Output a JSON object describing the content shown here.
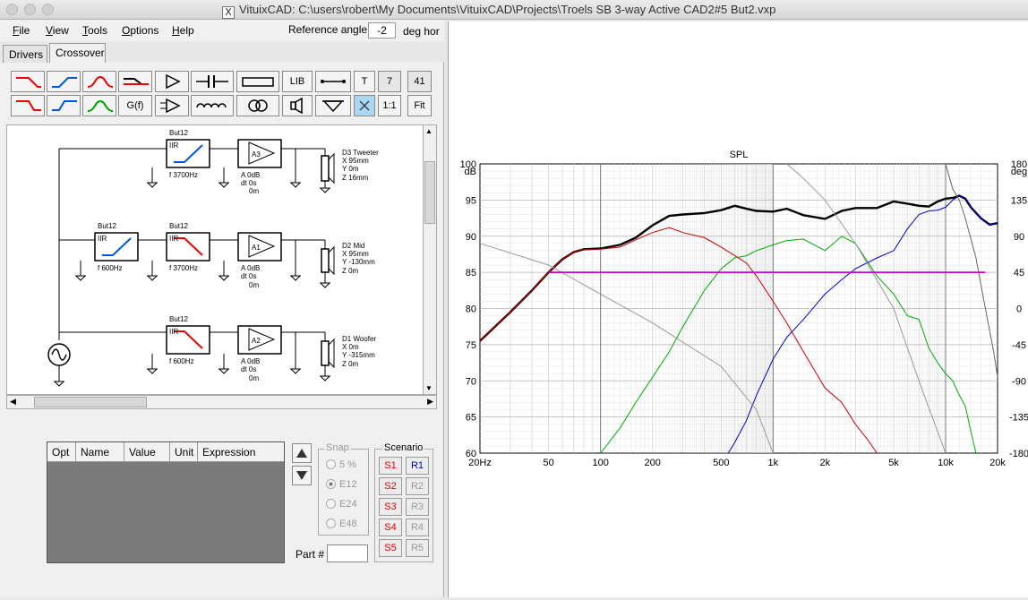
{
  "window": {
    "title": "VituixCAD: C:\\users\\robert\\My Documents\\VituixCAD\\Projects\\Troels SB 3-way Active CAD2#5 But2.vxp"
  },
  "menu": [
    "File",
    "View",
    "Tools",
    "Options",
    "Help"
  ],
  "menu_accel": [
    "F",
    "V",
    "T",
    "O",
    "H"
  ],
  "reference": {
    "label": "Reference angle",
    "value": "-2",
    "unit": "deg hor"
  },
  "tabs": [
    "Drivers",
    "Crossover"
  ],
  "toolbar": {
    "g_label": "G(f)",
    "lib_label": "LIB",
    "t_label": "T",
    "count1": "7",
    "count2": "41",
    "one_to_one": "1:1",
    "fit": "Fit"
  },
  "schematic": {
    "blocks": [
      {
        "title": "But12",
        "type": "IIR",
        "freq": "f  3700Hz"
      },
      {
        "title": "But12",
        "type": "IIR",
        "freq": "f  600Hz"
      },
      {
        "title": "But12",
        "type": "IIR",
        "freq": "f  3700Hz"
      },
      {
        "title": "But12",
        "type": "IIR",
        "freq": "f  600Hz"
      }
    ],
    "amps": [
      {
        "label": "A3",
        "gain": "A 0dB",
        "delay": "dt 0s",
        "dist": "0m"
      },
      {
        "label": "A1",
        "gain": "A 0dB",
        "delay": "dt 0s",
        "dist": "0m"
      },
      {
        "label": "A2",
        "gain": "A 0dB",
        "delay": "dt 0s",
        "dist": "0m"
      }
    ],
    "drivers": [
      {
        "name": "D3 Tweeter",
        "x": "X 95mm",
        "y": "Y 0m",
        "z": "Z 16mm"
      },
      {
        "name": "D2 Mid",
        "x": "X 95mm",
        "y": "Y -130mm",
        "z": "Z 0m"
      },
      {
        "name": "D1 Woofer",
        "x": "X 0m",
        "y": "Y -315mm",
        "z": "Z 0m"
      }
    ]
  },
  "params": {
    "headers": [
      "Opt",
      "Name",
      "Value",
      "Unit",
      "Expression"
    ]
  },
  "snap": {
    "label": "Snap",
    "options": [
      "5 %",
      "E12",
      "E24",
      "E48"
    ],
    "selected": "E12"
  },
  "scenario": {
    "label": "Scenario",
    "s": [
      "S1",
      "S2",
      "S3",
      "S4",
      "S5"
    ],
    "r": [
      "R1",
      "R2",
      "R3",
      "R4",
      "R5"
    ]
  },
  "part": {
    "label": "Part #"
  },
  "chart_data": {
    "type": "line",
    "title": "SPL",
    "xlabel": "",
    "ylabel": "dB",
    "y2label": "deg",
    "xscale": "log",
    "xlim": [
      20,
      20000
    ],
    "ylim": [
      60,
      100
    ],
    "y2lim": [
      -180,
      180
    ],
    "xticks": [
      "20Hz",
      "50",
      "100",
      "200",
      "500",
      "1k",
      "2k",
      "5k",
      "10k",
      "20k"
    ],
    "xtick_values": [
      20,
      50,
      100,
      200,
      500,
      1000,
      2000,
      5000,
      10000,
      20000
    ],
    "yticks": [
      60,
      65,
      70,
      75,
      80,
      85,
      90,
      95,
      100
    ],
    "y2ticks": [
      -180,
      -135,
      -90,
      -45,
      0,
      45,
      90,
      135,
      180
    ],
    "grid": true,
    "series": [
      {
        "color": "#000000",
        "x": [
          20,
          30,
          40,
          50,
          60,
          70,
          80,
          100,
          130,
          160,
          200,
          250,
          300,
          400,
          500,
          600,
          700,
          800,
          1000,
          1200,
          1500,
          2000,
          2500,
          3000,
          4000,
          5000,
          6000,
          7000,
          8000,
          9000,
          10000,
          11000,
          12000,
          13000,
          14000,
          16000,
          18000,
          20000
        ],
        "y": [
          75.5,
          79.5,
          82.5,
          85.0,
          86.8,
          87.8,
          88.2,
          88.3,
          88.8,
          89.8,
          91.5,
          92.8,
          93.0,
          93.2,
          93.6,
          94.2,
          93.8,
          93.5,
          93.4,
          93.8,
          92.9,
          92.4,
          93.5,
          93.9,
          93.9,
          94.8,
          94.5,
          94.2,
          94.1,
          94.8,
          95.2,
          95.3,
          95.6,
          95.2,
          94.0,
          92.5,
          91.6,
          91.8
        ]
      },
      {
        "color": "#cc0000",
        "x": [
          20,
          30,
          40,
          50,
          60,
          70,
          80,
          100,
          130,
          160,
          200,
          250,
          300,
          400,
          500,
          600,
          700,
          800,
          1000,
          1200,
          1500,
          2000,
          2500,
          3000,
          3500,
          4000
        ],
        "y": [
          75.5,
          79.5,
          82.5,
          85.0,
          86.8,
          87.8,
          88.2,
          88.2,
          88.5,
          89.5,
          90.5,
          91.2,
          90.5,
          89.8,
          88.5,
          87.3,
          86.3,
          84.5,
          81.0,
          78.0,
          74.0,
          69.0,
          67.0,
          64.0,
          62.0,
          60.0
        ]
      },
      {
        "color": "#00aa00",
        "x": [
          100,
          130,
          160,
          200,
          250,
          300,
          400,
          500,
          600,
          700,
          800,
          1000,
          1200,
          1500,
          2000,
          2500,
          3000,
          4000,
          5000,
          6000,
          7000,
          8000,
          9000,
          10000,
          11000,
          12000,
          13000,
          14000,
          15000
        ],
        "y": [
          60.0,
          63.5,
          67.0,
          70.5,
          74.0,
          77.5,
          82.5,
          85.5,
          87.0,
          87.3,
          88.0,
          88.8,
          89.4,
          89.6,
          88.0,
          90.0,
          89.0,
          84.5,
          82.0,
          79.0,
          78.5,
          74.5,
          72.5,
          71.0,
          70.0,
          68.0,
          66.5,
          63.0,
          60.0
        ]
      },
      {
        "color": "#0000cc",
        "x": [
          550,
          600,
          700,
          800,
          1000,
          1200,
          1500,
          2000,
          2500,
          3000,
          4000,
          5000,
          6000,
          7000,
          8000,
          9000,
          10000,
          11000,
          12000,
          13000,
          14000,
          16000,
          18000,
          20000
        ],
        "y": [
          60.0,
          61.5,
          64.5,
          68.0,
          73.0,
          76.0,
          78.5,
          82.0,
          84.0,
          85.5,
          87.0,
          88.0,
          91.0,
          93.0,
          93.5,
          93.6,
          94.0,
          95.0,
          95.6,
          95.3,
          94.0,
          92.5,
          91.6,
          91.8
        ]
      },
      {
        "color": "#999999",
        "x": [
          20,
          50,
          100,
          200,
          500,
          800,
          1000
        ],
        "y": [
          89.0,
          86.0,
          82.0,
          78.0,
          72.0,
          66.0,
          60.0
        ]
      },
      {
        "color": "#999999",
        "x": [
          1200,
          1500,
          2000,
          3000,
          5000,
          7000,
          10000
        ],
        "y": [
          100.0,
          98.0,
          95.0,
          89.0,
          80.0,
          70.0,
          60.0
        ]
      },
      {
        "color": "#666666",
        "x": [
          10000,
          11000,
          12000,
          13000,
          15000,
          17000,
          19000,
          20000
        ],
        "y": [
          100.0,
          96.5,
          95.0,
          92.5,
          87.0,
          80.0,
          74.0,
          70.5
        ]
      },
      {
        "color": "#cc00cc",
        "x": [
          50,
          17000
        ],
        "y": [
          85.0,
          85.0
        ]
      }
    ]
  }
}
